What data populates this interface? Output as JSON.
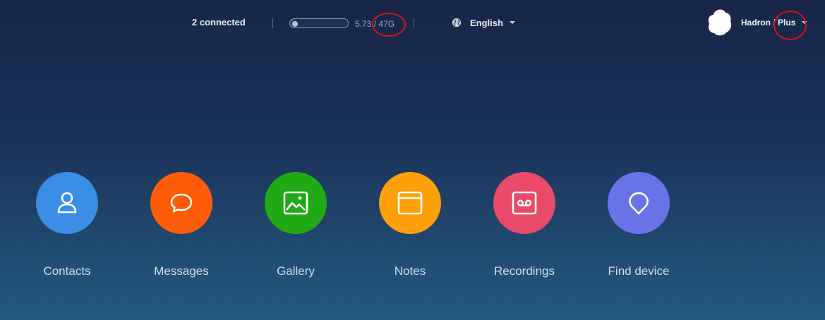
{
  "topbar": {
    "connected_text": "2 connected",
    "storage": {
      "used_label": "5.73",
      "separator": "/",
      "total_label": "47G",
      "used_fraction": 0.12
    },
    "language": {
      "label": "English",
      "icon": "globe-icon"
    },
    "account": {
      "name": "Hadron",
      "separator": "/",
      "plan": "Plus",
      "avatar_color": "#ffffff"
    }
  },
  "apps": [
    {
      "label": "Contacts",
      "icon": "person-icon",
      "color": "#3a8ee6"
    },
    {
      "label": "Messages",
      "icon": "chat-bubble-icon",
      "color": "#ff5c0a"
    },
    {
      "label": "Gallery",
      "icon": "image-icon",
      "color": "#22a916"
    },
    {
      "label": "Notes",
      "icon": "note-window-icon",
      "color": "#ff9f0a"
    },
    {
      "label": "Recordings",
      "icon": "cassette-icon",
      "color": "#ea4a6a"
    },
    {
      "label": "Find device",
      "icon": "location-pin-icon",
      "color": "#6a72e8"
    }
  ],
  "annotation_color": "#d0141e"
}
